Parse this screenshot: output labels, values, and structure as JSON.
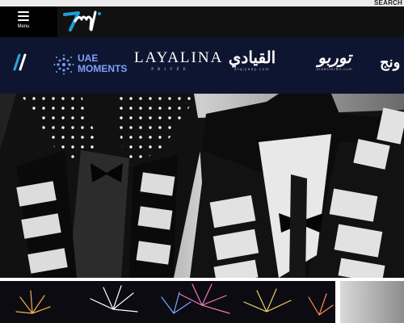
{
  "utility": {
    "search_label": "SEARCH"
  },
  "header": {
    "menu_label": "Menu",
    "logo_icon": "tamm-logo"
  },
  "partners": [
    {
      "name": "partner-mark",
      "icon": "partner-mark-logo"
    },
    {
      "name": "uae-moments",
      "text": "UAE\nMOMENTS",
      "icon": "uae-moments-logo"
    },
    {
      "name": "layalina",
      "text": "LAYALINA",
      "subtext": "PRIVÉE"
    },
    {
      "name": "alqiyadi",
      "text": "القيادي",
      "subtext": "alqiyady.com"
    },
    {
      "name": "arabsturbo",
      "text": "توربو",
      "subtext": "arabsturbo.com"
    },
    {
      "name": "partial-partner",
      "text": "ونج"
    }
  ],
  "hero": {
    "image": "two-performers-in-led-lit-tuxedos"
  },
  "tiles": [
    {
      "image": "fireworks-display"
    },
    {
      "image": "grey-gradient-tile"
    }
  ],
  "colors": {
    "header_bg": "#111111",
    "menu_bg": "#000000",
    "partners_bg": "#0e1530",
    "uae_accent": "#7ea0ff"
  }
}
